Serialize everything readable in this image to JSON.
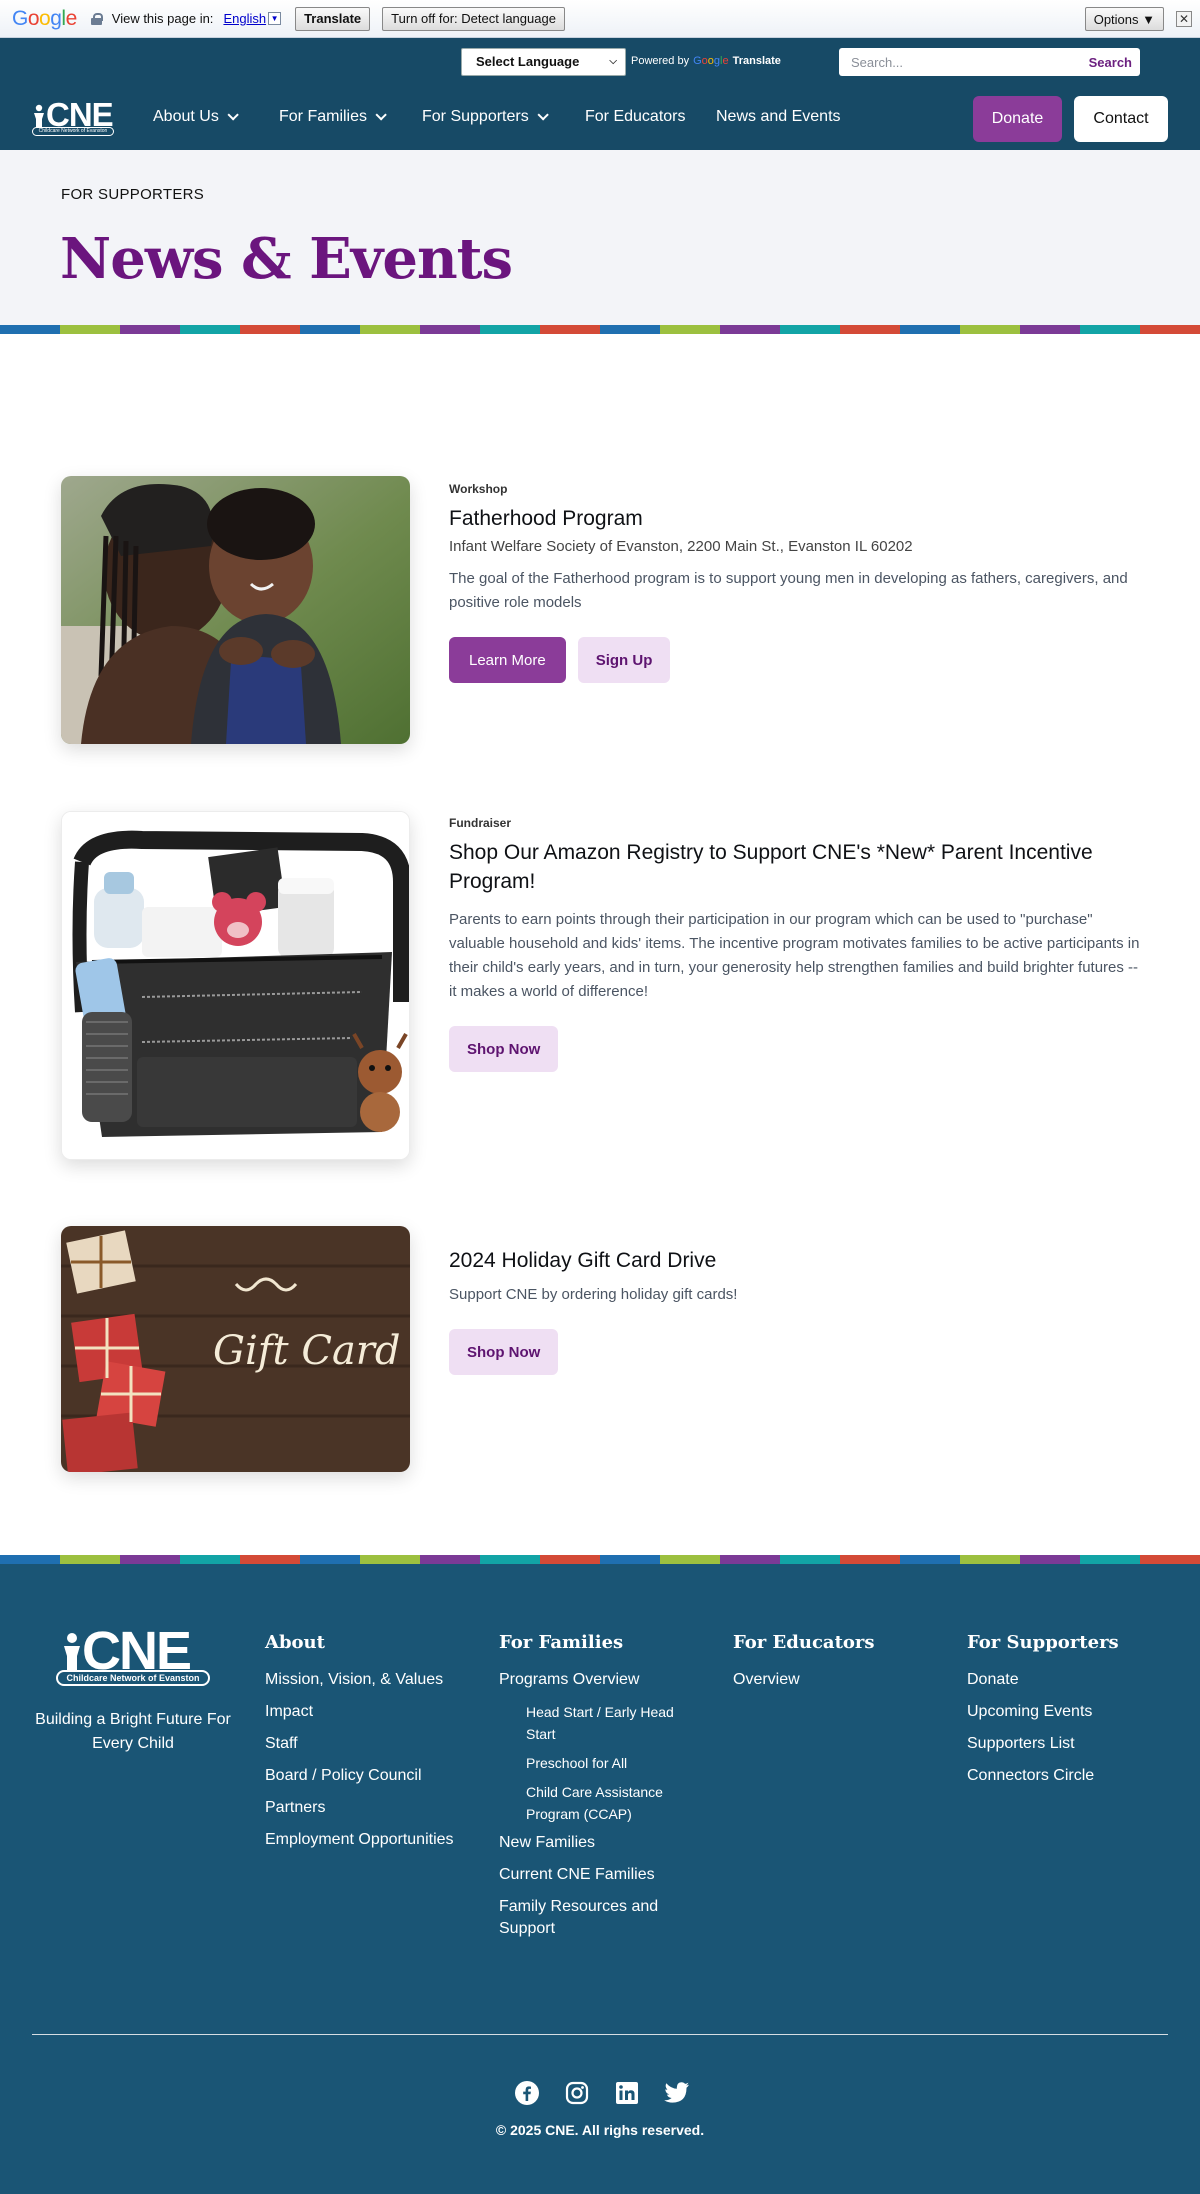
{
  "translate_bar": {
    "view_page_in": "View this page in:",
    "language": "English",
    "translate_button": "Translate",
    "turn_off_button": "Turn off for: Detect language",
    "options_button": "Options ▼"
  },
  "utility_bar": {
    "select_language": "Select Language",
    "powered_by": "Powered by",
    "google": "Google",
    "translate": "Translate",
    "search_placeholder": "Search...",
    "search_button": "Search"
  },
  "nav": {
    "logo_text": "CNE",
    "logo_sub": "Childcare Network of Evanston",
    "items": [
      "About Us",
      "For Families",
      "For Supporters",
      "For Educators",
      "News and Events"
    ],
    "donate": "Donate",
    "contact": "Contact"
  },
  "hero": {
    "eyebrow": "FOR SUPPORTERS",
    "title": "News & Events"
  },
  "strip_colors": [
    "#1f6fb0",
    "#9cc03f",
    "#7b3a96",
    "#12a4a6",
    "#d44a37"
  ],
  "events": [
    {
      "type": "Workshop",
      "title": "Fatherhood Program",
      "location": "Infant Welfare Society of Evanston, 2200 Main St., Evanston IL 60202",
      "description": "The goal of the Fatherhood program is to support young men in developing as fathers, caregivers, and positive role models",
      "primary_button": "Learn More",
      "secondary_button": "Sign Up"
    },
    {
      "type": "Fundraiser",
      "title": "Shop Our Amazon Registry to Support CNE's *New* Parent Incentive Program!",
      "description": "Parents to earn points through their participation in our program which can be used to \"purchase\" valuable household and kids' items. The incentive program motivates families to be active participants in their child's early years, and in turn, your generosity help strengthen families and build brighter futures -- it makes a world of difference!",
      "button": "Shop Now"
    },
    {
      "title": "2024 Holiday Gift Card Drive",
      "description": "Support CNE by ordering holiday gift cards!",
      "button": "Shop Now",
      "image_text": "Gift Card"
    }
  ],
  "footer": {
    "logo_text": "CNE",
    "logo_sub": "Childcare Network of Evanston",
    "tagline": "Building a Bright Future For Every Child",
    "columns": {
      "about": {
        "heading": "About",
        "links": [
          "Mission, Vision, & Values",
          "Impact",
          "Staff",
          "Board / Policy Council",
          "Partners",
          "Employment Opportunities"
        ]
      },
      "families": {
        "heading": "For Families",
        "programs": "Programs Overview",
        "sub_links": [
          "Head Start / Early Head Start",
          "Preschool for All",
          "Child Care Assistance Program (CCAP)"
        ],
        "links": [
          "New Families",
          "Current CNE Families",
          "Family Resources and Support"
        ]
      },
      "educators": {
        "heading": "For Educators",
        "links": [
          "Overview"
        ]
      },
      "supporters": {
        "heading": "For Supporters",
        "links": [
          "Donate",
          "Upcoming Events",
          "Supporters List",
          "Connectors Circle"
        ]
      }
    },
    "social_icons": [
      "facebook-icon",
      "instagram-icon",
      "linkedin-icon",
      "twitter-icon"
    ],
    "copyright": "© 2025 CNE. All righs reserved."
  }
}
